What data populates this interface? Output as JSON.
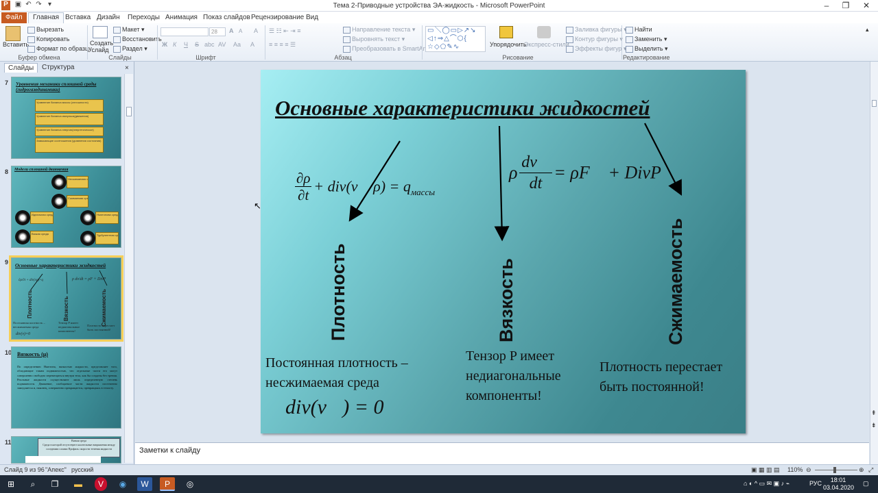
{
  "window": {
    "title": "Тема 2-Приводные устройства ЭА-жидкость  -  Microsoft PowerPoint",
    "app_icon": "P",
    "qat": [
      "save-icon",
      "undo-icon",
      "redo-icon",
      "customize-icon"
    ]
  },
  "tabs": [
    "Файл",
    "Главная",
    "Вставка",
    "Дизайн",
    "Переходы",
    "Анимация",
    "Показ слайдов",
    "Рецензирование",
    "Вид"
  ],
  "ribbon": {
    "clipboard": {
      "paste": "Вставить",
      "cut": "Вырезать",
      "copy": "Копировать",
      "format_painter": "Формат по образцу",
      "label": "Буфер обмена"
    },
    "slides": {
      "new_slide": "Создать слайд",
      "layout": "Макет",
      "reset": "Восстановить",
      "section": "Раздел",
      "label": "Слайды"
    },
    "font": {
      "size": "28",
      "label": "Шрифт",
      "bold": "Ж",
      "italic": "К",
      "underline": "Ч",
      "strike": "S",
      "shadow": "abc",
      "spacing": "AV",
      "case": "Aa",
      "clear": "A",
      "grow": "A",
      "shrink": "A"
    },
    "paragraph": {
      "text_direction": "Направление текста",
      "align_text": "Выровнять текст",
      "smartart": "Преобразовать в SmartArt",
      "label": "Абзац"
    },
    "drawing": {
      "arrange": "Упорядочить",
      "quick_styles": "Экспресс-стили",
      "fill": "Заливка фигуры",
      "outline": "Контур фигуры",
      "effects": "Эффекты фигур",
      "label": "Рисование"
    },
    "editing": {
      "find": "Найти",
      "replace": "Заменить",
      "select": "Выделить",
      "label": "Редактирование"
    }
  },
  "panel": {
    "tabs": [
      "Слайды",
      "Структура"
    ],
    "close": "×",
    "thumbs": [
      {
        "num": "7",
        "title": "Уравнения механики сплошной среды (гидрогазодинамики)",
        "items": [
          "Уравнение баланса массы (сплошности)",
          "Уравнение баланса импульса(движения)",
          "Уравнение баланса энергии(энергетическое)",
          "Замыкающие соотношения (уравнения состояния)"
        ]
      },
      {
        "num": "8",
        "title": "Модели сплошной двиюкения",
        "items": [
          "Несжимаемая среда",
          "Сжимаемая среда",
          "Идеальная среда",
          "Ньютонова среда",
          "Вязкая среда",
          "Турбулентная среда"
        ]
      },
      {
        "num": "9",
        "title": "Основные характеристики жидкостей",
        "items": [
          "Плотность",
          "Вязкость",
          "Сжимаемость",
          "Постоянная плотность – несжимаемая среда",
          "Тензор P имеет недиагональные компоненты!",
          "Плотность перестает быть постоянной!"
        ]
      },
      {
        "num": "10",
        "title": "Вязкость (μ)",
        "body": "По определению Ньютона, вязкостью жидкости, представляет того, обладающие таким подвижностью, что отдельные части его могут совершенно свободно перемещаться внутри тела, как бы созданы без трения. Реальные жидкости осуществляют лишь определенную степень подвижности. Движение, сообщаемое части жидкости постепенно замедляется и, наконец, совершенно прекращается, превращаясь в теплоту."
      },
      {
        "num": "11",
        "title": "Вязкая среда",
        "body": "Среда в которой отсутствуют касательные напряжения между соседними слоями  Профиль скорости течения жидкости"
      }
    ]
  },
  "slide": {
    "title": "Основные характеристики жидкостей",
    "formula_left": {
      "num": "∂ρ",
      "den": "∂t",
      "rest": "+ div(v⃗ ρ) = q",
      "sub": "массы"
    },
    "formula_right": {
      "rho": "ρ",
      "num": "dv⃗",
      "den": "dt",
      "rest": "= ρF⃗ + DivP"
    },
    "labels": [
      "Плотность",
      "Вязкость",
      "Сжимаемость"
    ],
    "desc": [
      "Постоянная плотность – несжимаемая среда",
      "Тензор P имеет недиагональные компоненты!",
      "Плотность перестает быть постоянной!"
    ],
    "formula_bottom": "div(v⃗) = 0"
  },
  "notes": {
    "placeholder": "Заметки к слайду"
  },
  "status": {
    "slide": "Слайд 9 из 96",
    "theme": "\"Апекс\"",
    "lang": "русский",
    "zoom": "110%"
  },
  "taskbar": {
    "time": "18:01",
    "date": "03.04.2020",
    "lang": "РУС"
  }
}
